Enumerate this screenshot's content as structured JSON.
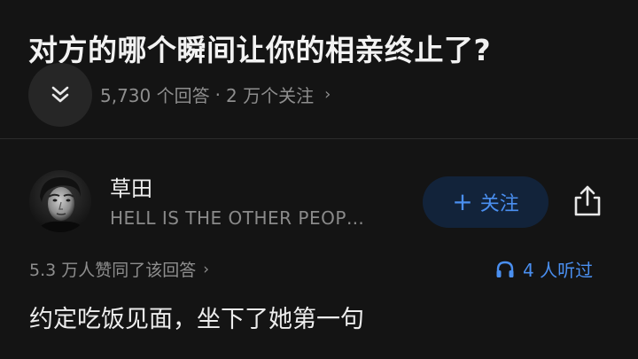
{
  "question": {
    "title": "对方的哪个瞬间让你的相亲终止了?",
    "answer_count": "5,730 个回答",
    "separator": "·",
    "followers": "2 万个关注",
    "chevron": "›"
  },
  "author": {
    "name": "草田",
    "bio": "HELL IS THE OTHER PEOP…",
    "follow_plus": "+",
    "follow_label": "关注"
  },
  "answer": {
    "likes": "5.3 万人赞同了该回答",
    "likes_chevron": "›",
    "listeners": "4 人听过",
    "first_line": "约定吃饭见面，坐下了她第一句"
  },
  "icons": {
    "expand": "double-chevron-down-icon",
    "share": "share-icon",
    "listen": "headphones-icon"
  },
  "colors": {
    "background": "#141414",
    "accent": "#4a8ff0",
    "follow_bg": "#12233a",
    "muted": "#8e8e8e"
  }
}
